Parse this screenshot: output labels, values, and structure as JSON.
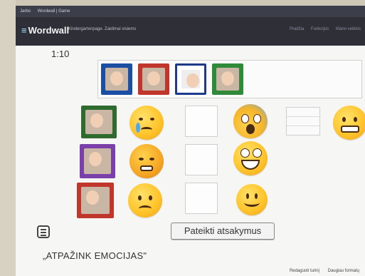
{
  "browser": {
    "tab1": "Jarbo",
    "tab2": "Wordwall | Game"
  },
  "header": {
    "logo": "Wordwall",
    "breadcrumb": "Kindergartenpage. Zaidimai visiems",
    "nav": [
      "Pradžia",
      "Funkcijos",
      "Mano veiklos"
    ]
  },
  "game": {
    "timer": "1:10",
    "bank_photos": [
      {
        "frame": "#1b4fa3"
      },
      {
        "frame": "#c0362c"
      },
      {
        "frame": "#1e3a8a"
      },
      {
        "frame": "#2f8a3a"
      }
    ],
    "row_photos": [
      {
        "frame": "#2f6b2f"
      },
      {
        "frame": "#7a3fa8"
      },
      {
        "frame": "#c0362c"
      }
    ],
    "emojis_left": [
      "crying-face",
      "angry-face",
      "sad-face"
    ],
    "emojis_right": [
      "screaming-face",
      "laughing-face",
      "smiling-face"
    ],
    "emoji_far_right": "grimacing-face",
    "submit_label": "Pateikti atsakymus",
    "activity_title": "„ATPAŽINK EMOCIJAS\""
  },
  "footer": {
    "edit": "Redaguoti turinį",
    "more": "Daugiau formatų"
  }
}
